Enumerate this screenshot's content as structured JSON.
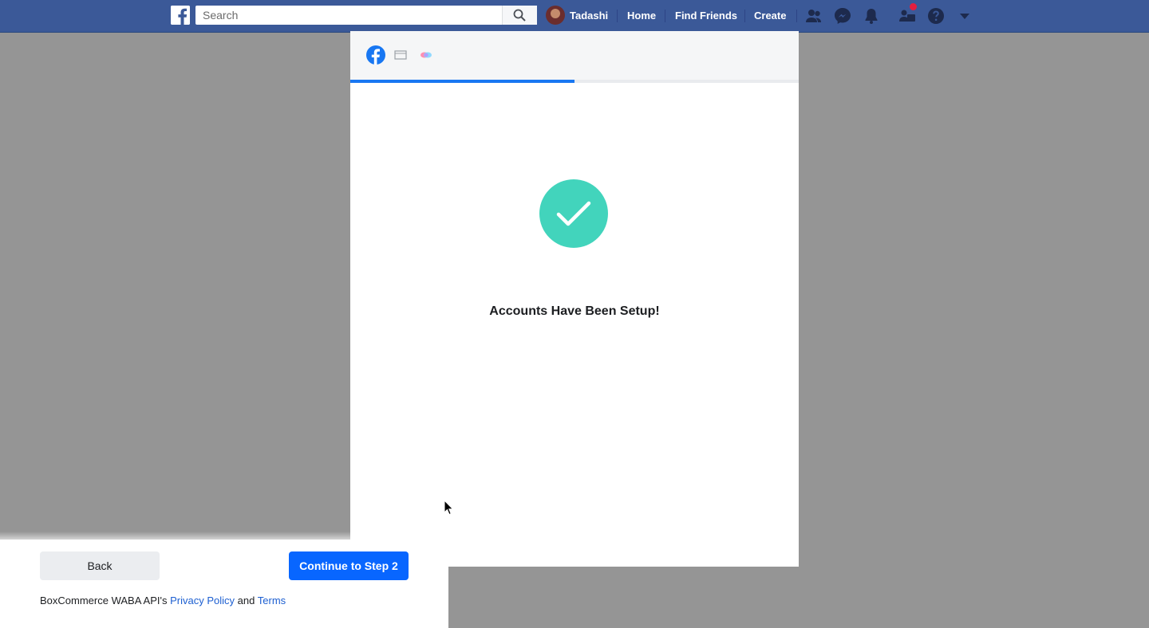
{
  "topbar": {
    "search_placeholder": "Search",
    "profile_name": "Tadashi",
    "nav_home": "Home",
    "nav_find_friends": "Find Friends",
    "nav_create": "Create",
    "icons": [
      "facebook-logo-icon",
      "search-icon",
      "friend-requests-icon",
      "messenger-icon",
      "notifications-icon",
      "quick-help-people-icon",
      "help-icon",
      "account-dropdown-icon"
    ],
    "brand_color": "#3b5998"
  },
  "modal": {
    "progress_fraction": 0.5,
    "header_icons": [
      "facebook-icon",
      "business-manager-icon",
      "waba-icon"
    ],
    "title": "Accounts Have Been Setup!",
    "success_color": "#42d4bc"
  },
  "footer": {
    "back_label": "Back",
    "continue_label": "Continue to Step 2",
    "prefix_text": "BoxCommerce WABA API's",
    "privacy_link": "Privacy Policy",
    "and_text": "and",
    "terms_link": "Terms",
    "primary_color": "#0866ff"
  }
}
